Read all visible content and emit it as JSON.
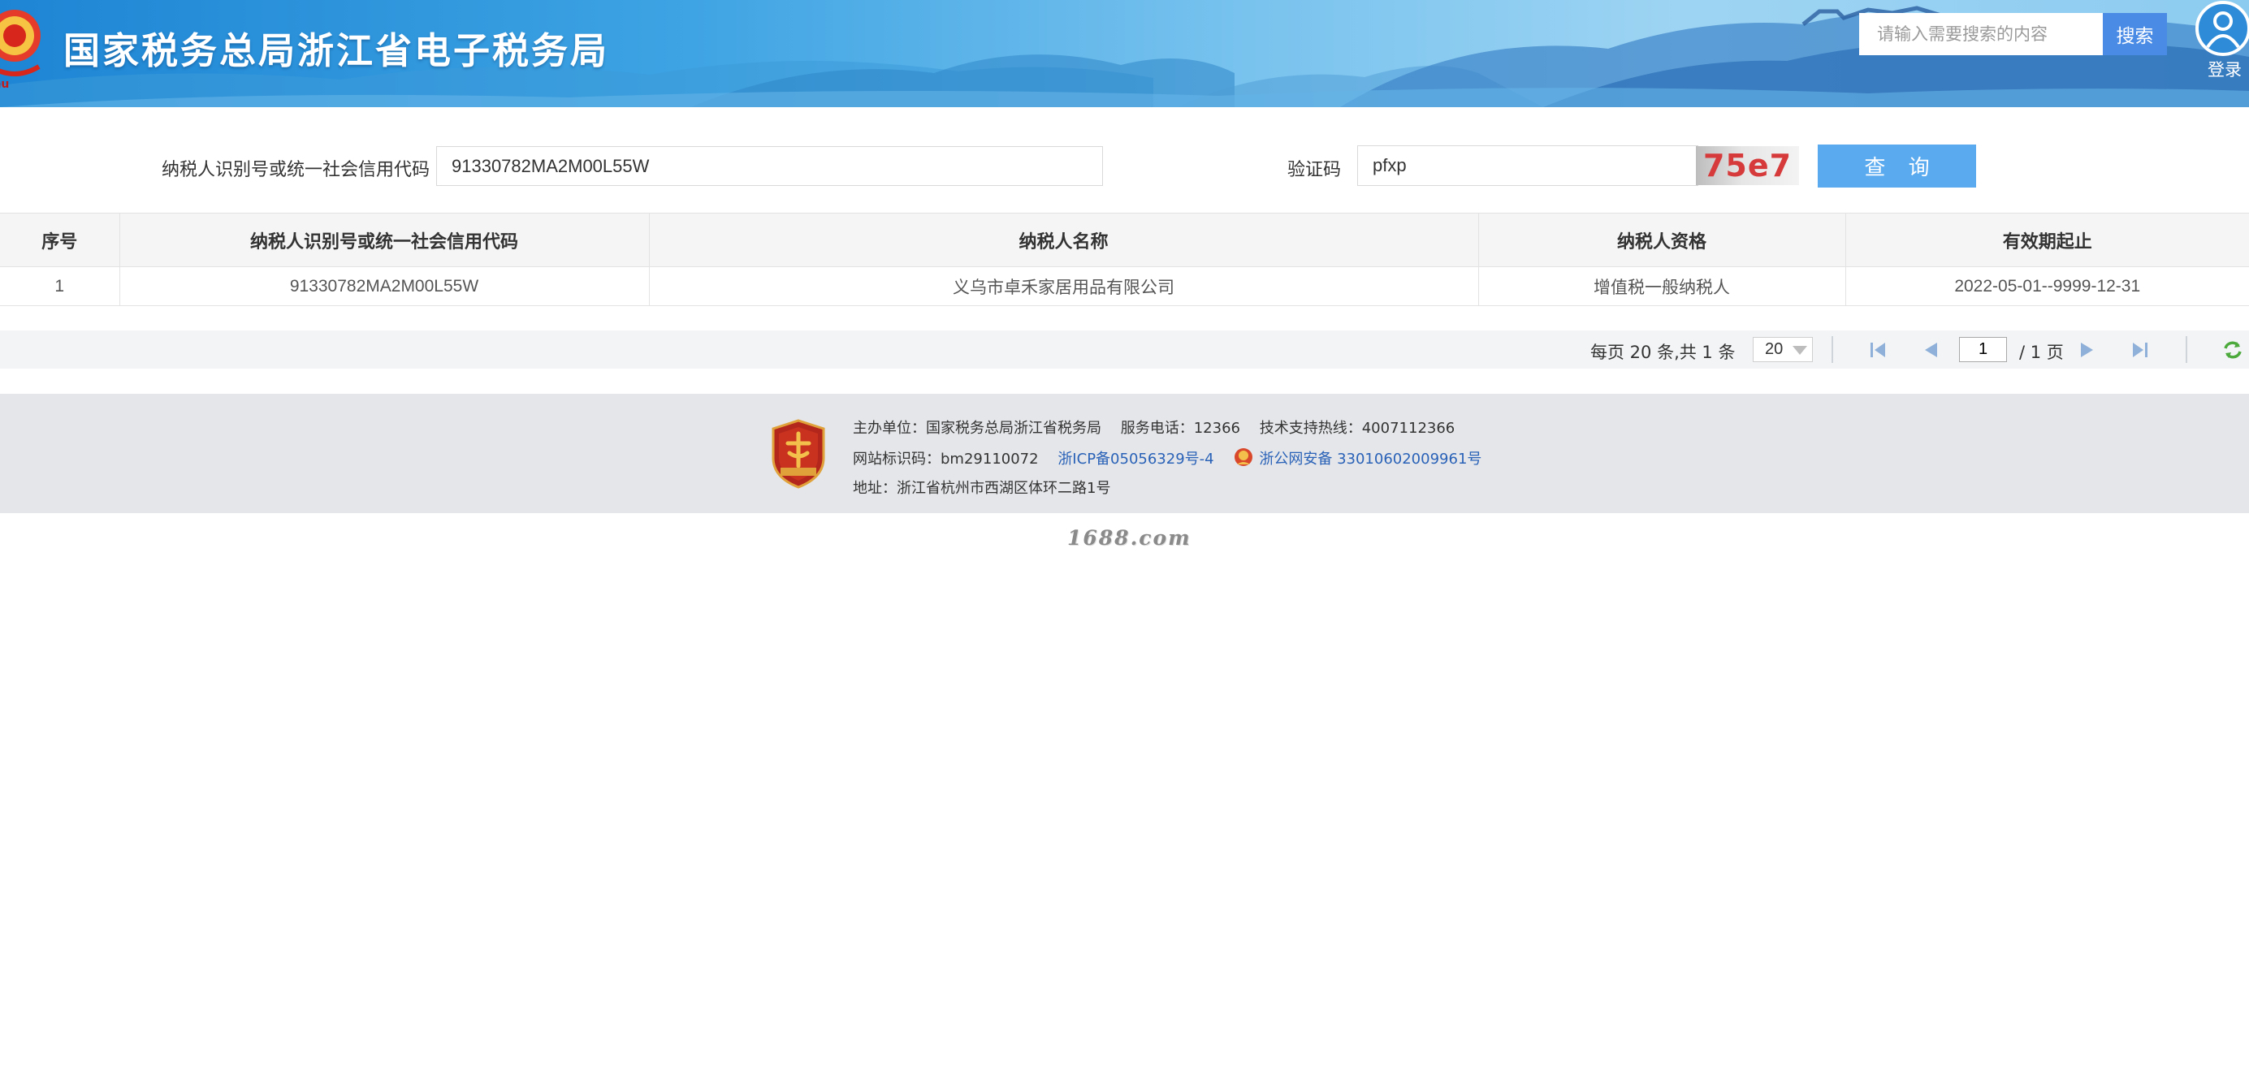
{
  "header": {
    "site_title": "国家税务总局浙江省电子税务局",
    "search_placeholder": "请输入需要搜索的内容",
    "search_label": "搜索",
    "login_label": "登录",
    "emblem_icon": "national-tax-emblem-icon",
    "avatar_icon": "user-avatar-icon"
  },
  "query": {
    "taxid_label": "纳税人识别号或统一社会信用代码",
    "taxid_value": "91330782MA2M00L55W",
    "captcha_label": "验证码",
    "captcha_value": "pfxp",
    "captcha_image_text": "75e7",
    "query_button": "查 询",
    "accent_color": "#5aaaf0"
  },
  "table": {
    "headers": [
      "序号",
      "纳税人识别号或统一社会信用代码",
      "纳税人名称",
      "纳税人资格",
      "有效期起止"
    ],
    "rows": [
      [
        "1",
        "91330782MA2M00L55W",
        "义乌市卓禾家居用品有限公司",
        "增值税一般纳税人",
        "2022-05-01--9999-12-31"
      ]
    ]
  },
  "pagination": {
    "summary": "每页 20 条,共 1 条",
    "page_size": "20",
    "current_page": "1",
    "total_pages": "/ 1 页"
  },
  "footer": {
    "sponsor": "主办单位：国家税务总局浙江省税务局",
    "service_phone": "服务电话：12366",
    "tech_hotline": "技术支持热线：4007112366",
    "site_id": "网站标识码：bm29110072",
    "icp": "浙ICP备05056329号-4",
    "police_record": "浙公网安备 33010602009961号",
    "address": "地址：浙江省杭州市西湖区体环二路1号"
  },
  "watermark": "1688.com"
}
